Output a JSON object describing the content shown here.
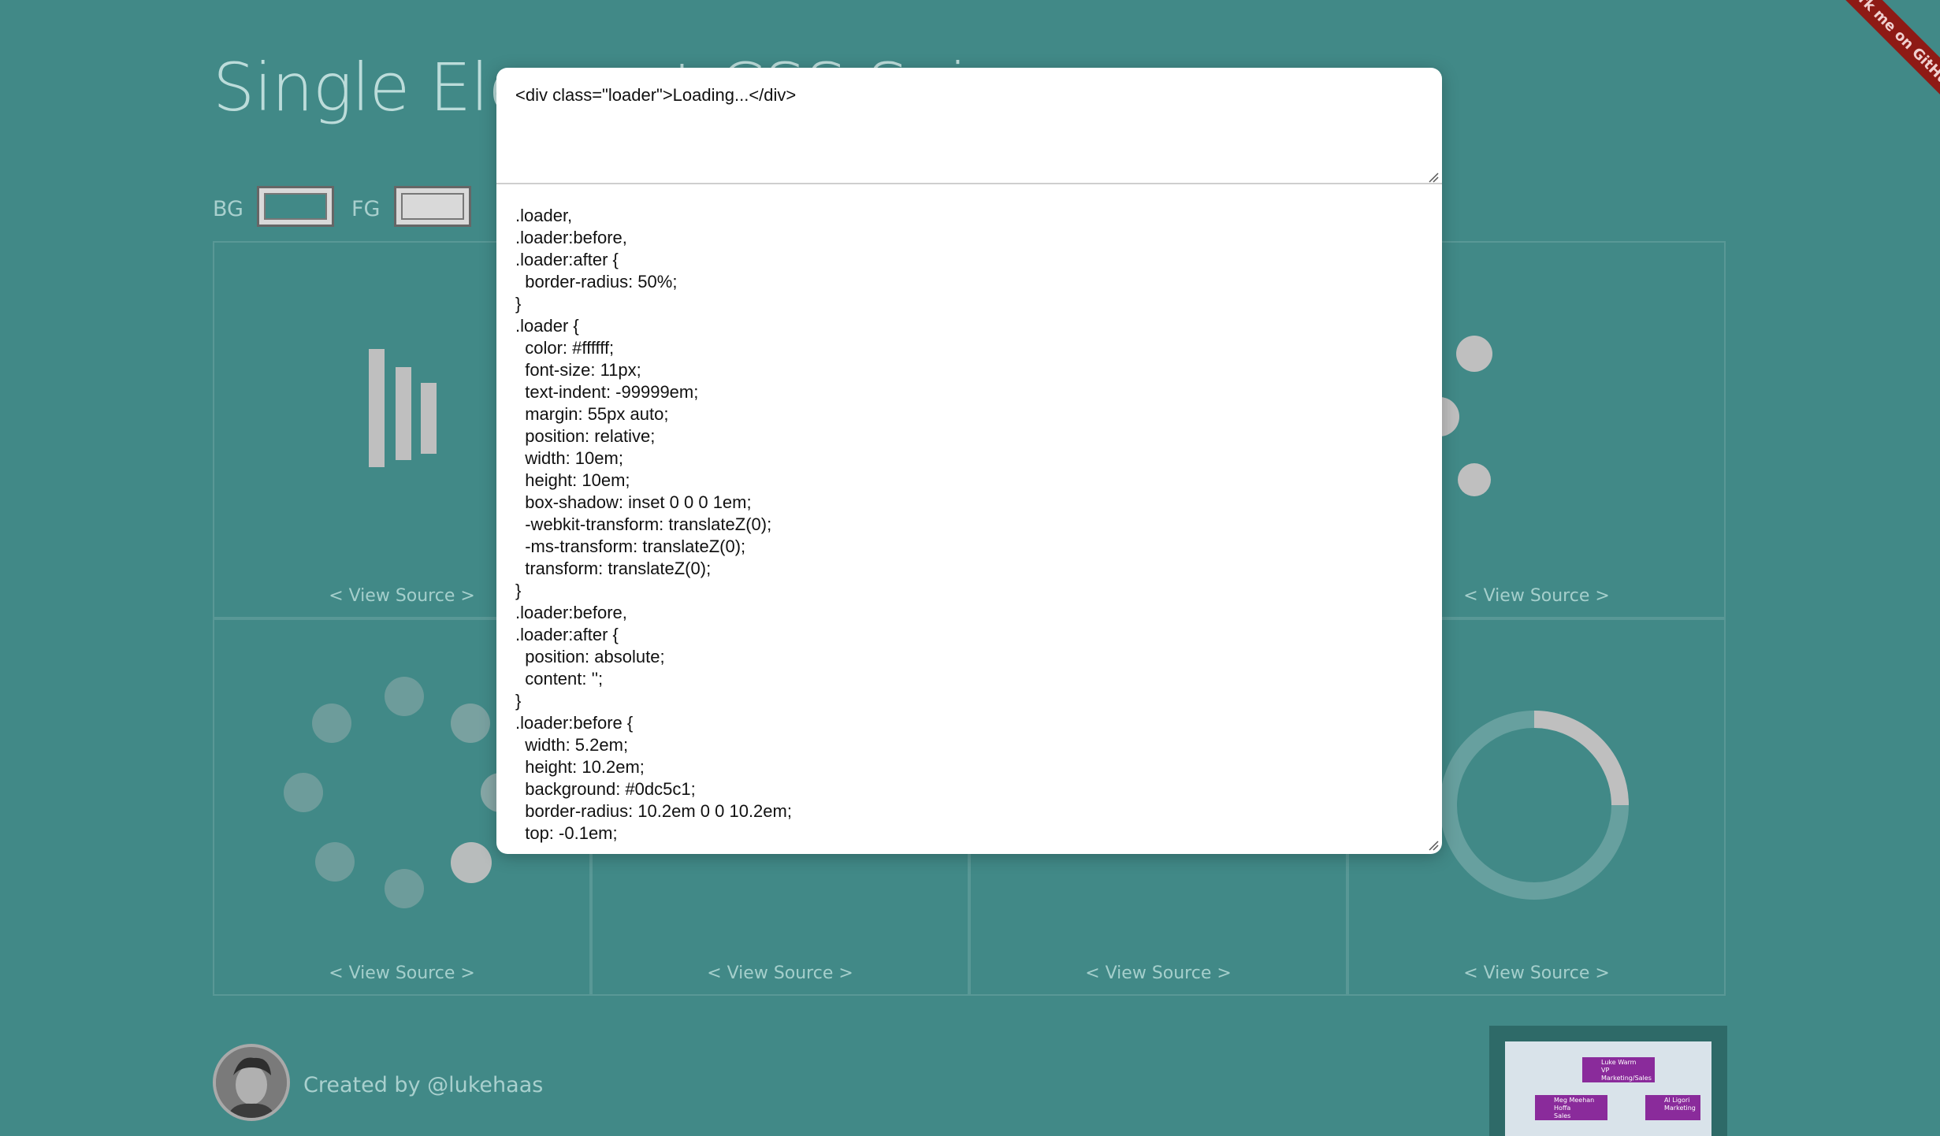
{
  "page": {
    "title": "Single Element CSS Spinners",
    "bg_label": "BG",
    "fg_label": "FG",
    "view_source_label": "< View Source >",
    "footer_credit": "Created by @lukehaas",
    "ribbon_text": "Fork me on GitHub"
  },
  "colors": {
    "background": "#418987",
    "spinner": "#bfbfbf",
    "ribbon": "#8e1a15",
    "modal": "#ffffff"
  },
  "modal": {
    "html_code": "<div class=\"loader\">Loading...</div>",
    "css_code": ".loader,\n.loader:before,\n.loader:after {\n  border-radius: 50%;\n}\n.loader {\n  color: #ffffff;\n  font-size: 11px;\n  text-indent: -99999em;\n  margin: 55px auto;\n  position: relative;\n  width: 10em;\n  height: 10em;\n  box-shadow: inset 0 0 0 1em;\n  -webkit-transform: translateZ(0);\n  -ms-transform: translateZ(0);\n  transform: translateZ(0);\n}\n.loader:before,\n.loader:after {\n  position: absolute;\n  content: '';\n}\n.loader:before {\n  width: 5.2em;\n  height: 10.2em;\n  background: #0dc5c1;\n  border-radius: 10.2em 0 0 10.2em;\n  top: -0.1em;"
  },
  "promo": {
    "boxes": [
      {
        "name": "Luke Warm",
        "title": "VP Marketing/Sales"
      },
      {
        "name": "Meg Meehan Hoffa",
        "title": "Sales"
      },
      {
        "name": "Al Ligori",
        "title": "Marketing"
      }
    ]
  }
}
